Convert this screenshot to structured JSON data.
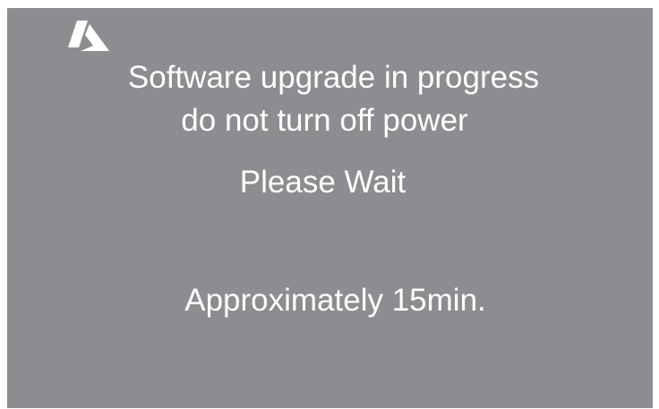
{
  "screen": {
    "background_color": "#8c8d91",
    "text_color": "#ffffff",
    "logo_icon": "azure-logo-icon",
    "message_line1": "Software upgrade in progress",
    "message_line2": "do not turn off power",
    "wait_text": "Please Wait",
    "eta_text": "Approximately 15min."
  }
}
